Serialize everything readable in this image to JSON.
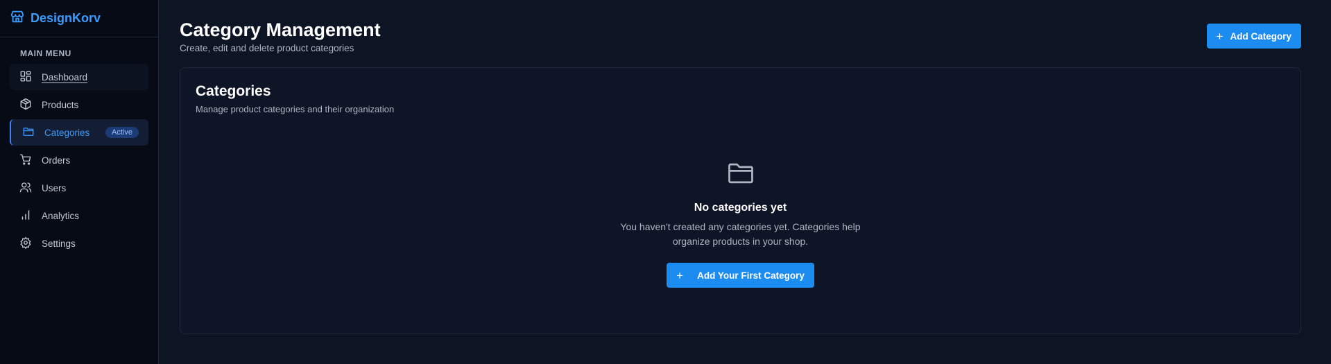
{
  "brand": {
    "name": "DesignKorv",
    "icon": "store-icon"
  },
  "sidebar": {
    "heading": "MAIN MENU",
    "items": [
      {
        "label": "Dashboard",
        "icon": "dashboard-icon"
      },
      {
        "label": "Products",
        "icon": "package-icon"
      },
      {
        "label": "Categories",
        "icon": "folder-icon",
        "badge": "Active"
      },
      {
        "label": "Orders",
        "icon": "cart-icon"
      },
      {
        "label": "Users",
        "icon": "users-icon"
      },
      {
        "label": "Analytics",
        "icon": "bar-chart-icon"
      },
      {
        "label": "Settings",
        "icon": "gear-icon"
      }
    ]
  },
  "header": {
    "title": "Category Management",
    "subtitle": "Create, edit and delete product categories",
    "add_button": "Add Category"
  },
  "card": {
    "title": "Categories",
    "description": "Manage product categories and their organization",
    "empty": {
      "title": "No categories yet",
      "text": "You haven't created any categories yet. Categories help organize products in your shop.",
      "button": "Add Your First Category"
    }
  },
  "colors": {
    "accent": "#1d8cf0",
    "brand": "#3b9cff",
    "background": "#0d1424",
    "sidebar": "#070b16"
  }
}
